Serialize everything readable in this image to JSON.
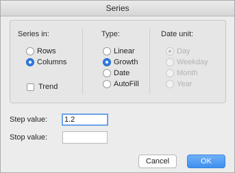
{
  "window": {
    "title": "Series"
  },
  "series_in": {
    "heading": "Series in:",
    "options": [
      {
        "label": "Rows",
        "selected": false
      },
      {
        "label": "Columns",
        "selected": true
      }
    ],
    "trend_label": "Trend",
    "trend_checked": false
  },
  "type": {
    "heading": "Type:",
    "options": [
      {
        "label": "Linear",
        "selected": false
      },
      {
        "label": "Growth",
        "selected": true
      },
      {
        "label": "Date",
        "selected": false
      },
      {
        "label": "AutoFill",
        "selected": false
      }
    ]
  },
  "date_unit": {
    "heading": "Date unit:",
    "enabled": false,
    "options": [
      {
        "label": "Day",
        "selected": true
      },
      {
        "label": "Weekday",
        "selected": false
      },
      {
        "label": "Month",
        "selected": false
      },
      {
        "label": "Year",
        "selected": false
      }
    ]
  },
  "step": {
    "label": "Step value:",
    "value": "1.2"
  },
  "stop": {
    "label": "Stop value:",
    "value": ""
  },
  "buttons": {
    "cancel": "Cancel",
    "ok": "OK"
  },
  "colors": {
    "accent": "#2f7de0",
    "ok_button": "#3d8ff0"
  }
}
